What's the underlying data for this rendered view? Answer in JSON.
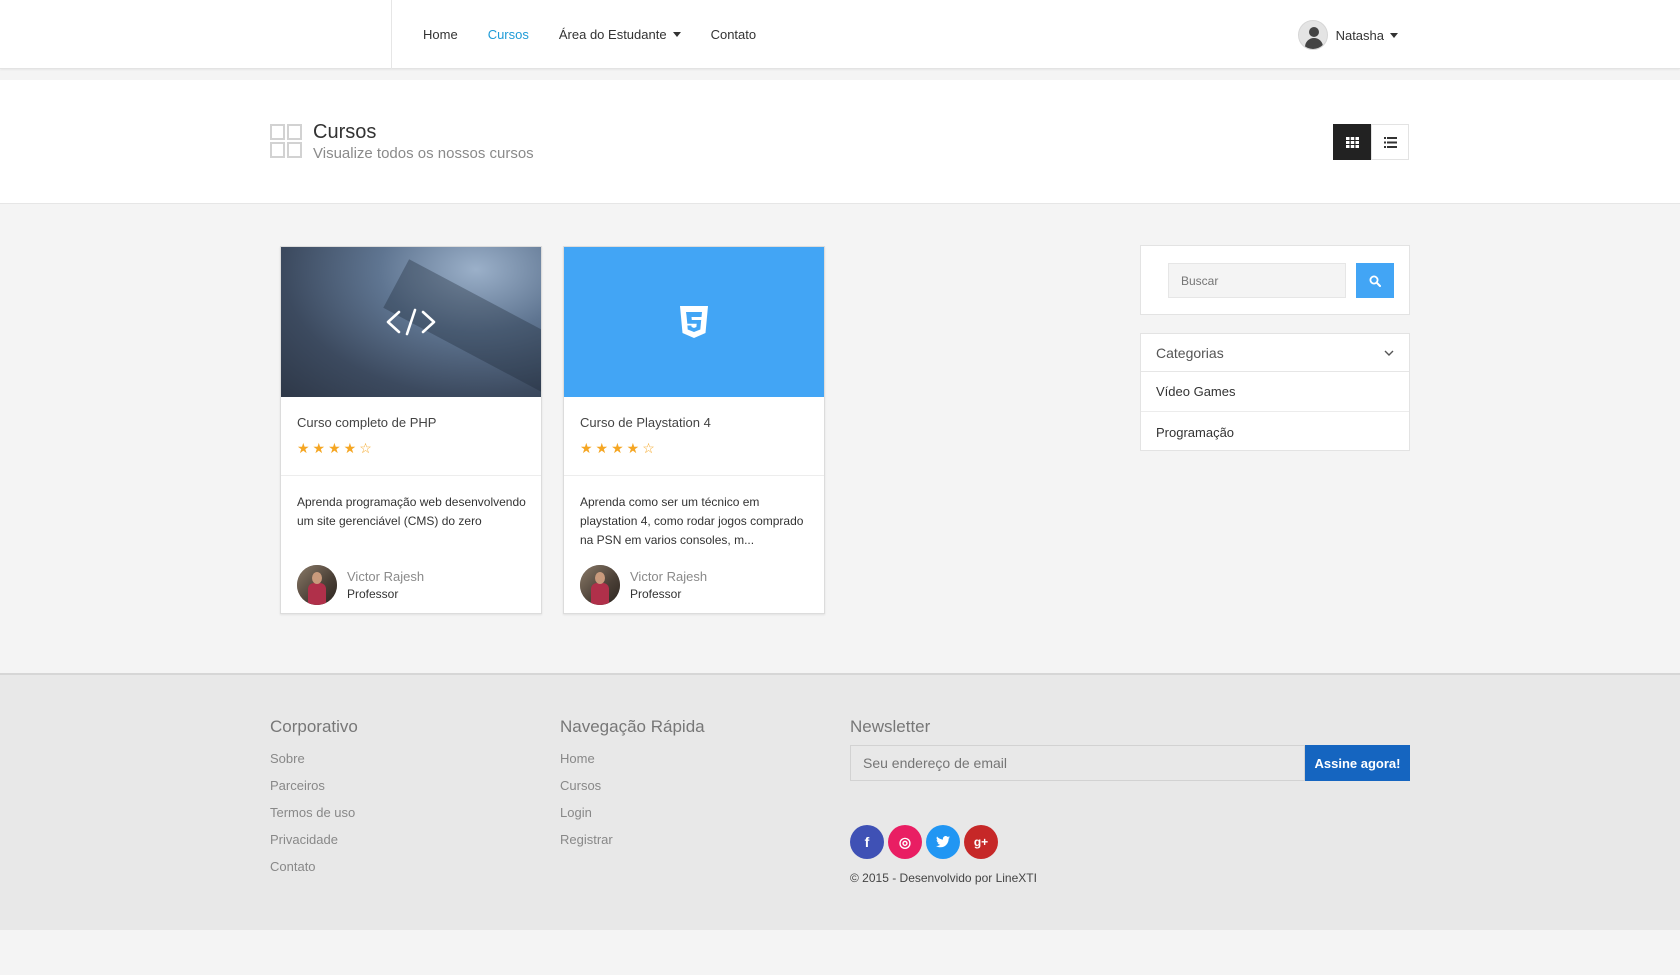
{
  "nav": {
    "links": [
      {
        "label": "Home"
      },
      {
        "label": "Cursos"
      },
      {
        "label": "Área do Estudante"
      },
      {
        "label": "Contato"
      }
    ],
    "user": {
      "name": "Natasha"
    }
  },
  "header": {
    "title": "Cursos",
    "subtitle": "Visualize todos os nossos cursos"
  },
  "courses": [
    {
      "title": "Curso completo de PHP",
      "rating": 4,
      "rating_max": 5,
      "stars": "★★★★☆",
      "description": "Aprenda programação web desenvolvendo um site gerenciável (CMS) do zero",
      "author": "Victor Rajesh",
      "role": "Professor",
      "thumb_icon": "code-icon"
    },
    {
      "title": "Curso de Playstation 4",
      "rating": 4,
      "rating_max": 5,
      "stars": "★★★★☆",
      "description": "Aprenda como ser um técnico em playstation 4, como rodar jogos comprado na PSN em varios consoles, m...",
      "author": "Victor Rajesh",
      "role": "Professor",
      "thumb_icon": "css3-icon"
    }
  ],
  "sidebar": {
    "search_placeholder": "Buscar",
    "categories_label": "Categorias",
    "categories": [
      {
        "label": "Vídeo Games"
      },
      {
        "label": "Programação"
      }
    ]
  },
  "footer": {
    "col1": {
      "heading": "Corporativo",
      "links": [
        "Sobre",
        "Parceiros",
        "Termos de uso",
        "Privacidade",
        "Contato"
      ]
    },
    "col2": {
      "heading": "Navegação Rápida",
      "links": [
        "Home",
        "Cursos",
        "Login",
        "Registrar"
      ]
    },
    "newsletter": {
      "heading": "Newsletter",
      "placeholder": "Seu endereço de email",
      "button": "Assine agora!"
    },
    "socials": [
      {
        "icon": "facebook-icon",
        "glyph": "f",
        "color": "#3f51b5"
      },
      {
        "icon": "dribbble-icon",
        "glyph": "◎",
        "color": "#e91e63"
      },
      {
        "icon": "twitter-icon",
        "glyph": "🐦",
        "color": "#2196f3"
      },
      {
        "icon": "google-plus-icon",
        "glyph": "g+",
        "color": "#c62828"
      }
    ],
    "copyright": "© 2015 - Desenvolvido por LineXTI"
  },
  "colors": {
    "accent": "#1e9bd7",
    "search_button": "#42a5f5",
    "newsletter_button": "#1565c0",
    "star": "#f5a623"
  }
}
